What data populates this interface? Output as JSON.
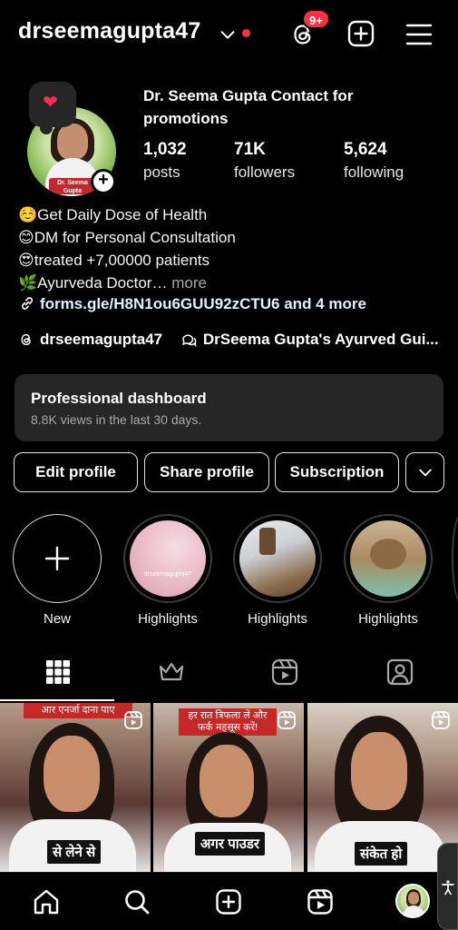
{
  "header": {
    "username": "drseemagupta47",
    "notification_badge": "9+"
  },
  "profile": {
    "display_name": "Dr. Seema Gupta Contact for promotions",
    "avatar_tag": "Dr. Seema Gupta",
    "note_icon": "heart",
    "stats": [
      {
        "value": "1,032",
        "label": "posts"
      },
      {
        "value": "71K",
        "label": "followers"
      },
      {
        "value": "5,624",
        "label": "following"
      }
    ],
    "bio": [
      "☺️Get Daily Dose of Health",
      "😊DM for Personal Consultation",
      "😍treated +7,00000 patients",
      "🌿Ayurveda Doctor…"
    ],
    "bio_more": " more",
    "link": "forms.gle/H8N1ou6GUU92zCTU6 and 4 more",
    "threads_handle": "drseemagupta47",
    "channel_name": "DrSeema Gupta's Ayurved Gui..."
  },
  "dashboard": {
    "title": "Professional dashboard",
    "subtitle": "8.8K views in the last 30 days."
  },
  "actions": {
    "edit": "Edit profile",
    "share": "Share profile",
    "subscription": "Subscription"
  },
  "highlights": {
    "new_label": "New",
    "items": [
      {
        "label": "Highlights",
        "caption": "drseemagupta47"
      },
      {
        "label": "Highlights"
      },
      {
        "label": "Highlights"
      }
    ]
  },
  "posts": [
    {
      "caption": "से लेने से",
      "banner": "आर एनर्जा दाना पाए"
    },
    {
      "caption": "अगर पाउडर",
      "banner": "हर रात त्रिफला लें और फर्क महसूस करें!"
    },
    {
      "caption": "संकेत हो"
    }
  ],
  "colors": {
    "background": "#000000",
    "surface": "#262626",
    "accent_red": "#ff3040"
  }
}
